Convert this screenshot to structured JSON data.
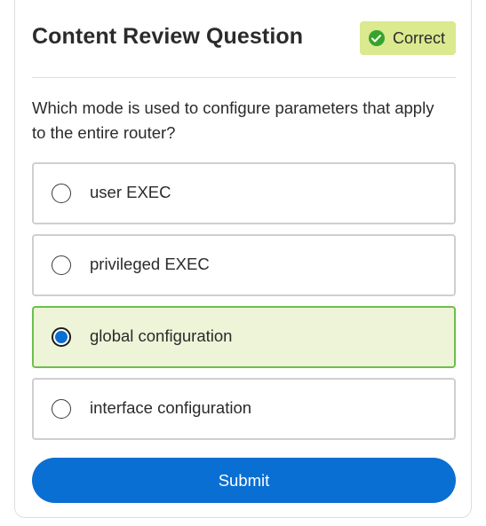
{
  "header": {
    "title": "Content Review Question",
    "status_badge": {
      "label": "Correct",
      "icon": "check-circle-icon",
      "color": "#dbe98f",
      "icon_color": "#37a32c"
    }
  },
  "question": {
    "text": "Which mode is used to configure parameters that apply to the entire router?"
  },
  "options": [
    {
      "label": "user EXEC",
      "selected": false
    },
    {
      "label": "privileged EXEC",
      "selected": false
    },
    {
      "label": "global configuration",
      "selected": true
    },
    {
      "label": "interface configuration",
      "selected": false
    }
  ],
  "submit": {
    "label": "Submit",
    "color": "#0a6fd3"
  },
  "colors": {
    "selected_border": "#6cc04a",
    "selected_background": "#eef4d7",
    "radio_selected": "#0a6fd3"
  }
}
